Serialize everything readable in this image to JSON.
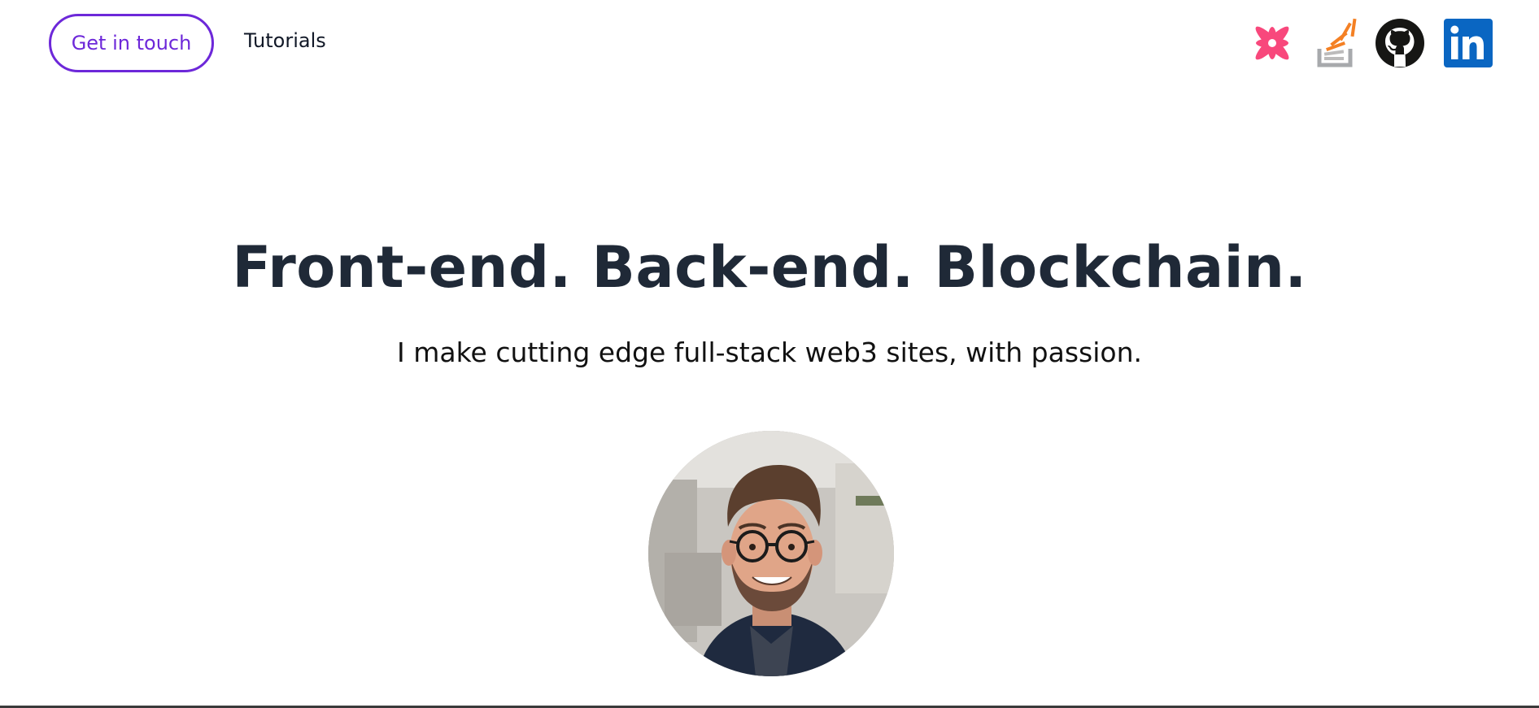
{
  "nav": {
    "contact_label": "Get in touch",
    "tutorials_label": "Tutorials"
  },
  "social": [
    {
      "name": "zulip-icon",
      "color": "#f8487c"
    },
    {
      "name": "stackoverflow-icon",
      "color": "#f48024"
    },
    {
      "name": "github-icon",
      "color": "#161614"
    },
    {
      "name": "linkedin-icon",
      "color": "#0a66c2"
    }
  ],
  "hero": {
    "title": "Front-end. Back-end. Blockchain.",
    "subtitle": "I make cutting edge full-stack web3 sites, with passion."
  },
  "colors": {
    "accent": "#6d28d9",
    "heading": "#1f2937"
  }
}
